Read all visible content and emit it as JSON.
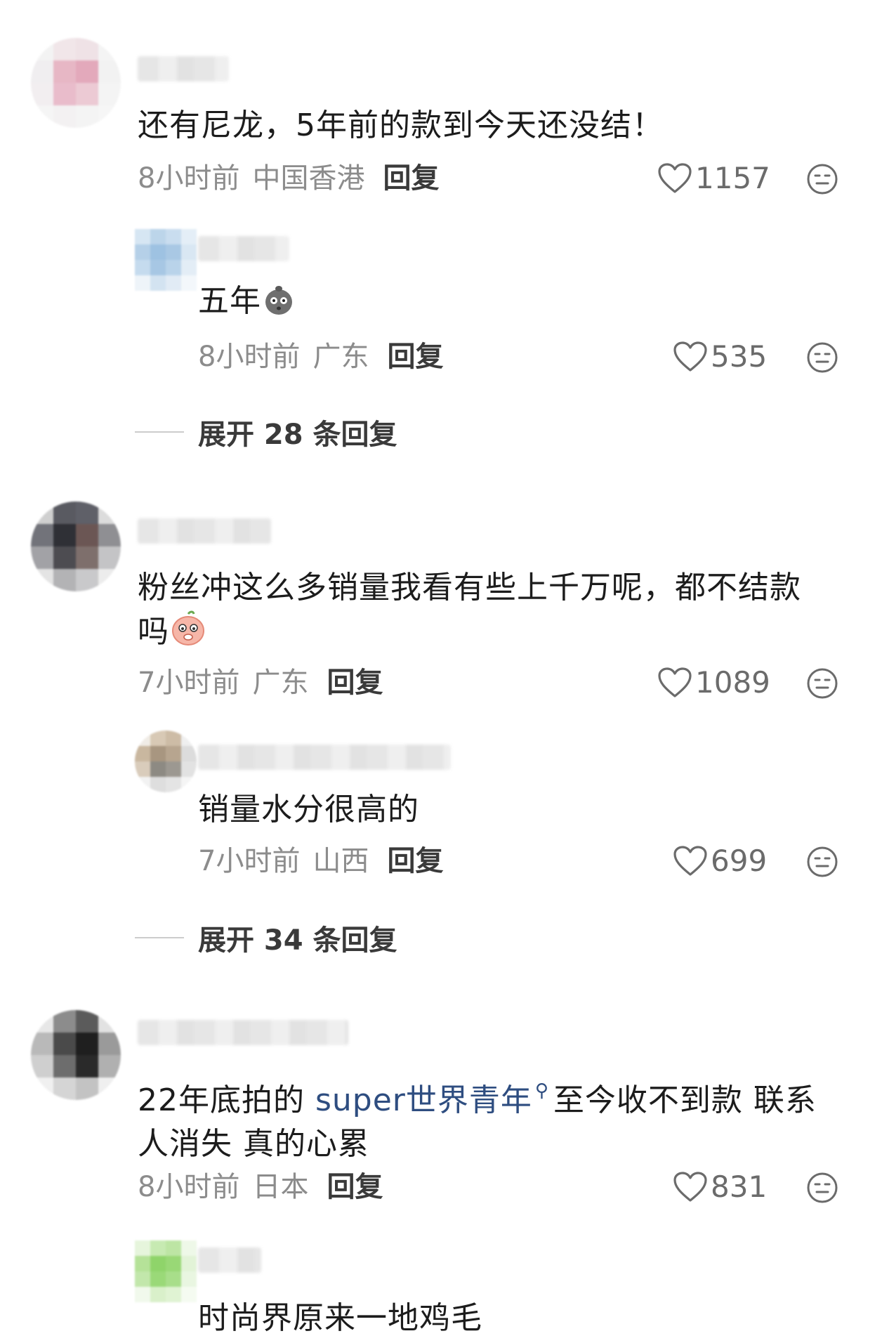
{
  "comments": [
    {
      "text": "还有尼龙，5年前的款到今天还没结！",
      "time": "8小时前",
      "location": "中国香港",
      "reply_label": "回复",
      "likes": "1157",
      "sub_reply": {
        "text": "五年",
        "time": "8小时前",
        "location": "广东",
        "reply_label": "回复",
        "likes": "535"
      },
      "expand_label": "展开 28 条回复"
    },
    {
      "text_line1": "粉丝冲这么多销量我看有些上千万呢，都不结款",
      "text_line2": "吗",
      "time": "7小时前",
      "location": "广东",
      "reply_label": "回复",
      "likes": "1089",
      "sub_reply": {
        "text": "销量水分很高的",
        "time": "7小时前",
        "location": "山西",
        "reply_label": "回复",
        "likes": "699"
      },
      "expand_label": "展开 34 条回复"
    },
    {
      "text_prefix": "22年底拍的 ",
      "text_link": "super世界青年",
      "text_suffix": "至今收不到款 联系",
      "text_line2": "人消失 真的心累",
      "time": "8小时前",
      "location": "日本",
      "reply_label": "回复",
      "likes": "831",
      "sub_reply": {
        "text": "时尚界原来一地鸡毛"
      }
    }
  ],
  "icons": {
    "like": "heart-outline-icon",
    "dislike": "neutral-face-icon",
    "search_mark": "search-icon"
  },
  "colors": {
    "meta_text": "#8c8c8c",
    "link": "#2e4d80",
    "body_text": "#1c1c1c"
  }
}
